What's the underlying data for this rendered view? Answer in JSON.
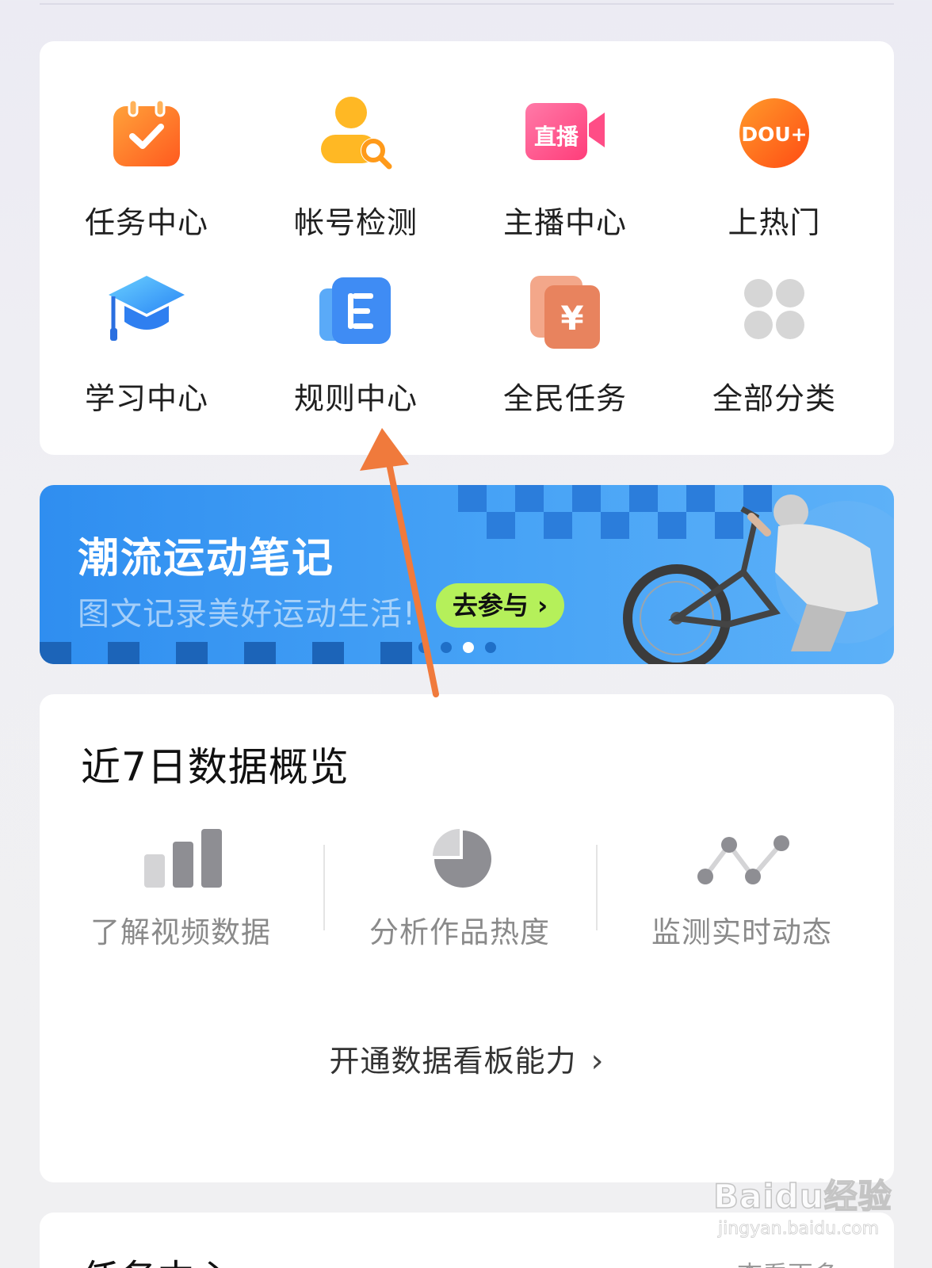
{
  "tools": [
    {
      "label": "任务中心",
      "icon": "task-calendar-icon"
    },
    {
      "label": "帐号检测",
      "icon": "account-check-icon"
    },
    {
      "label": "主播中心",
      "icon": "live-camera-icon",
      "icon_text": "直播"
    },
    {
      "label": "上热门",
      "icon": "dou-plus-icon",
      "icon_text": "DOU+"
    },
    {
      "label": "学习中心",
      "icon": "graduation-cap-icon"
    },
    {
      "label": "规则中心",
      "icon": "rules-document-icon"
    },
    {
      "label": "全民任务",
      "icon": "yuan-cards-icon"
    },
    {
      "label": "全部分类",
      "icon": "grid-dots-icon"
    }
  ],
  "banner": {
    "title": "潮流运动笔记",
    "subtitle": "图文记录美好运动生活!",
    "cta": "去参与",
    "dots": 4,
    "active_dot": 2
  },
  "data_overview": {
    "title": "近7日数据概览",
    "stats": [
      {
        "label": "了解视频数据",
        "icon": "bar-chart-icon"
      },
      {
        "label": "分析作品热度",
        "icon": "pie-chart-icon"
      },
      {
        "label": "监测实时动态",
        "icon": "line-trend-icon"
      }
    ],
    "open_link": "开通数据看板能力"
  },
  "task_section": {
    "title": "任务中心",
    "more": "查看更多"
  },
  "watermark": {
    "brand": "Baidu经验",
    "url": "jingyan.baidu.com"
  },
  "colors": {
    "accent_orange": "#ff6a2b",
    "banner_blue": "#3a97f3",
    "cta_green": "#b5f05a",
    "annotation_arrow": "#f07a3c"
  }
}
